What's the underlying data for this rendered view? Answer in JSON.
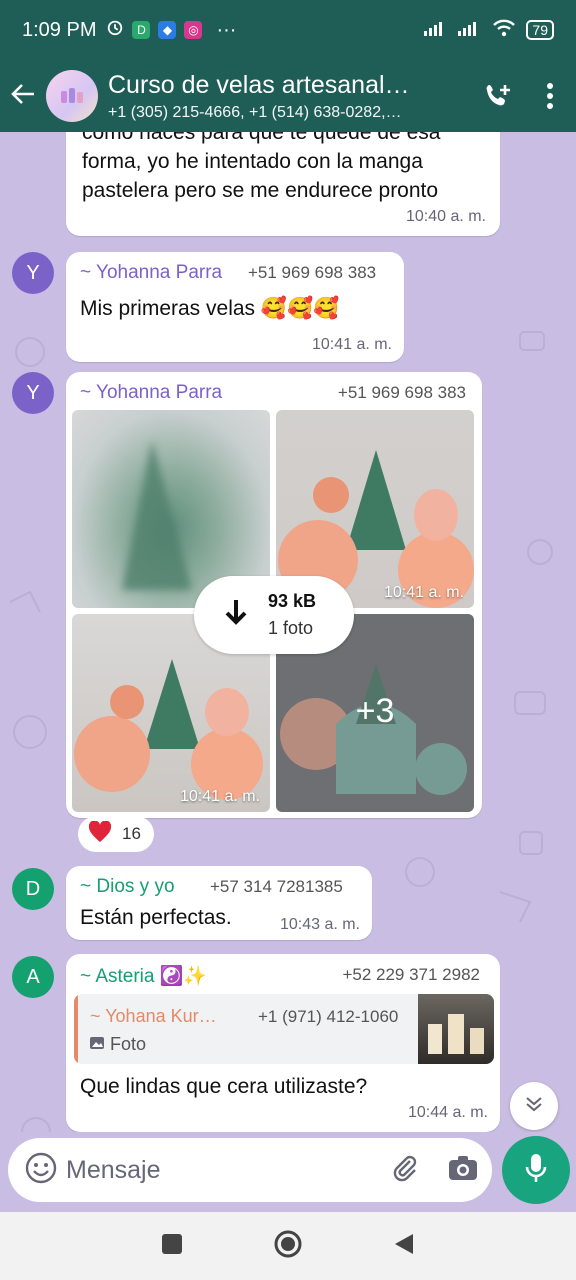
{
  "status": {
    "time": "1:09 PM",
    "battery": "79",
    "more": "···"
  },
  "header": {
    "title": "Curso de velas artesanal…",
    "subtitle": "+1 (305) 215-4666, +1 (514) 638-0282,…"
  },
  "messages": [
    {
      "text": "cómo haces para que te quede de esa forma, yo he intentado con la manga pastelera pero se me endurece pronto",
      "line1": "como haces para que te quede de esa",
      "line2": "forma, yo he intentado con la manga",
      "line3": "pastelera pero se me endurece pronto",
      "time": "10:40 a. m."
    },
    {
      "avatar_letter": "Y",
      "sender": "~ Yohanna Parra",
      "phone": "+51 969 698 383",
      "text": "Mis primeras velas 🥰🥰🥰",
      "time": "10:41 a. m."
    },
    {
      "avatar_letter": "Y",
      "sender": "~ Yohanna Parra",
      "phone": "+51 969 698 383",
      "photo_times": [
        "10:41 a. m.",
        "10:41 a. m.",
        "10:41 a. m."
      ],
      "more_count": "+3",
      "download_size": "93 kB",
      "download_count": "1 foto",
      "reaction_emoji": "❤️",
      "reaction_count": "16"
    },
    {
      "avatar_letter": "D",
      "sender": "~ Dios y yo",
      "phone": "+57 314 7281385",
      "text": "Están perfectas.",
      "time": "10:43 a. m."
    },
    {
      "avatar_letter": "A",
      "sender": "~ Asteria ☯️✨",
      "phone": "+52 229 371 2982",
      "quote_sender": "~ Yohana Kur…",
      "quote_phone": "+1 (971) 412-1060",
      "quote_text": "Foto",
      "text": "Que lindas que cera utilizaste?",
      "time": "10:44 a. m."
    }
  ],
  "composer": {
    "placeholder": "Mensaje"
  },
  "colors": {
    "header": "#1f5e57",
    "chat_bg": "#c9bde3",
    "accent_green": "#18a47e",
    "sender_yohanna": "#7b62c9",
    "sender_dios": "#14a06f",
    "sender_asteria": "#13a16f",
    "quote_sender": "#e4896a"
  }
}
